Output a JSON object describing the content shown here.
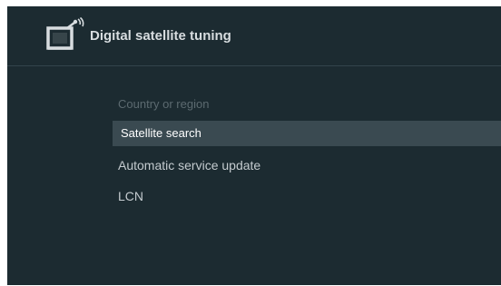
{
  "header": {
    "title": "Digital satellite tuning",
    "icon": "satellite-tv-icon"
  },
  "menu": {
    "items": [
      {
        "label": "Country or region",
        "state": "disabled"
      },
      {
        "label": "Satellite search",
        "state": "selected"
      },
      {
        "label": "Automatic service update",
        "state": "normal"
      },
      {
        "label": "LCN",
        "state": "normal"
      }
    ]
  },
  "colors": {
    "background": "#1c2b31",
    "selected_row": "#3a4a51",
    "text": "#c4cbcf",
    "disabled_text": "#5c6a70",
    "title_text": "#d8dde0"
  }
}
